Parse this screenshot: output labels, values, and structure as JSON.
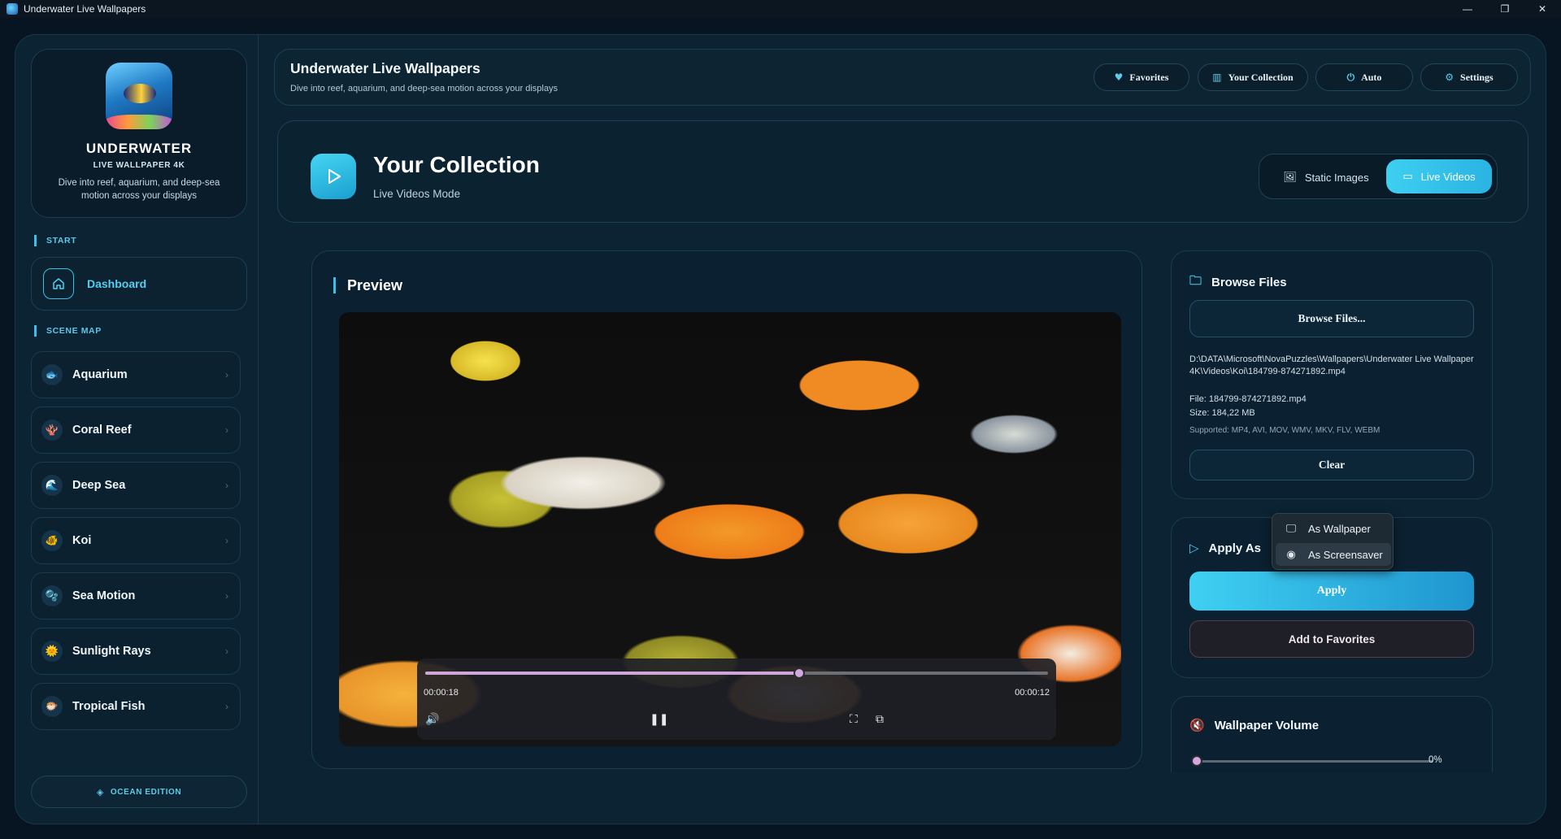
{
  "window": {
    "title": "Underwater Live Wallpapers",
    "controls": [
      "—",
      "❐",
      "✕"
    ]
  },
  "brand": {
    "title": "UNDERWATER",
    "subtitle": "LIVE WALLPAPER 4K",
    "description": "Dive into reef, aquarium, and deep-sea motion across your displays"
  },
  "sidebar": {
    "start_label": "START",
    "dashboard_label": "Dashboard",
    "scene_map_label": "SCENE MAP",
    "scenes": [
      {
        "label": "Aquarium",
        "icon": "🐟"
      },
      {
        "label": "Coral Reef",
        "icon": "🪸"
      },
      {
        "label": "Deep Sea",
        "icon": "🌊"
      },
      {
        "label": "Koi",
        "icon": "🐠"
      },
      {
        "label": "Sea Motion",
        "icon": "🫧"
      },
      {
        "label": "Sunlight Rays",
        "icon": "🌞"
      },
      {
        "label": "Tropical Fish",
        "icon": "🐡"
      }
    ],
    "edition_label": "OCEAN EDITION"
  },
  "header": {
    "title": "Underwater Live Wallpapers",
    "subtitle": "Dive into reef, aquarium, and deep-sea motion across your displays",
    "buttons": {
      "favorites": "Favorites",
      "collection": "Your Collection",
      "auto": "Auto",
      "settings": "Settings"
    }
  },
  "mode": {
    "title": "Your Collection",
    "subtitle": "Live Videos Mode",
    "static_label": "Static Images",
    "live_label": "Live Videos",
    "selected": "Live Videos"
  },
  "preview": {
    "title": "Preview",
    "current_time": "00:00:18",
    "remaining_time": "00:00:12",
    "progress": 0.6
  },
  "browse": {
    "title": "Browse Files",
    "button_label": "Browse Files...",
    "path": "D:\\DATA\\Microsoft\\NovaPuzzles\\Wallpapers\\Underwater Live Wallpaper 4K\\Videos\\Koi\\184799-874271892.mp4",
    "file_line": "File: 184799-874271892.mp4",
    "size_line": "Size: 184,22 MB",
    "supported_line": "Supported: MP4, AVI, MOV, WMV, MKV, FLV, WEBM",
    "clear_label": "Clear"
  },
  "apply": {
    "title": "Apply As",
    "apply_label": "Apply",
    "favorites_label": "Add to Favorites",
    "dropdown_options": [
      "As Wallpaper",
      "As Screensaver"
    ],
    "dropdown_highlighted": "As Screensaver"
  },
  "volume": {
    "title": "Wallpaper Volume",
    "value_label": "0%",
    "value": 0
  },
  "colors": {
    "accent": "#3fcff1",
    "background": "#071522",
    "panel": "#0b2131"
  }
}
